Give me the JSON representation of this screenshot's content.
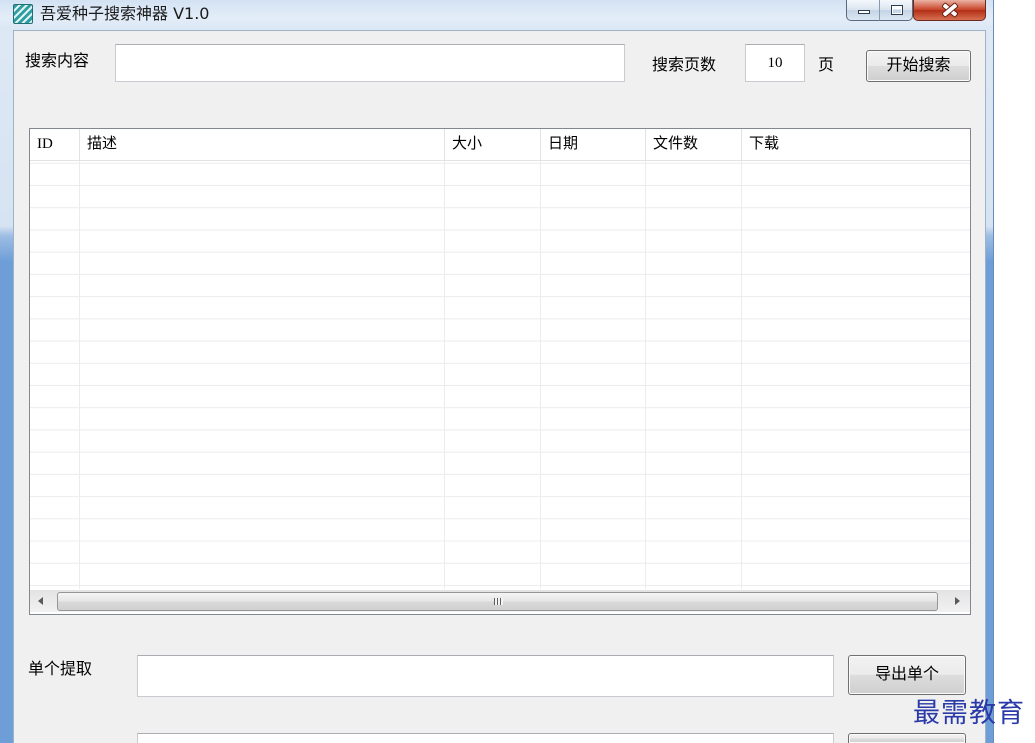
{
  "window": {
    "title": "吾爱种子搜索神器 V1.0"
  },
  "icons": {
    "app": "app-icon",
    "minimize": "minimize-icon",
    "maximize": "maximize-icon",
    "close": "close-icon",
    "scroll_left": "scroll-left-arrow-icon",
    "scroll_right": "scroll-right-arrow-icon",
    "scroll_grip": "scroll-grip-icon"
  },
  "search": {
    "label": "搜索内容",
    "query_value": "",
    "pages_label": "搜索页数",
    "pages_value": "10",
    "pages_unit": "页",
    "start_button": "开始搜索"
  },
  "results_table": {
    "columns": [
      "ID",
      "描述",
      "大小",
      "日期",
      "文件数",
      "下载"
    ],
    "rows": []
  },
  "extract_single": {
    "label": "单个提取",
    "value": "",
    "export_button": "导出单个"
  },
  "extract_next": {
    "value": ""
  },
  "watermark": "最需教育",
  "colors": {
    "close_button": "#c9462c",
    "watermark": "#2a3aa8",
    "frame_blue": "#6d9ed8",
    "client_background": "#f0f0f0"
  }
}
